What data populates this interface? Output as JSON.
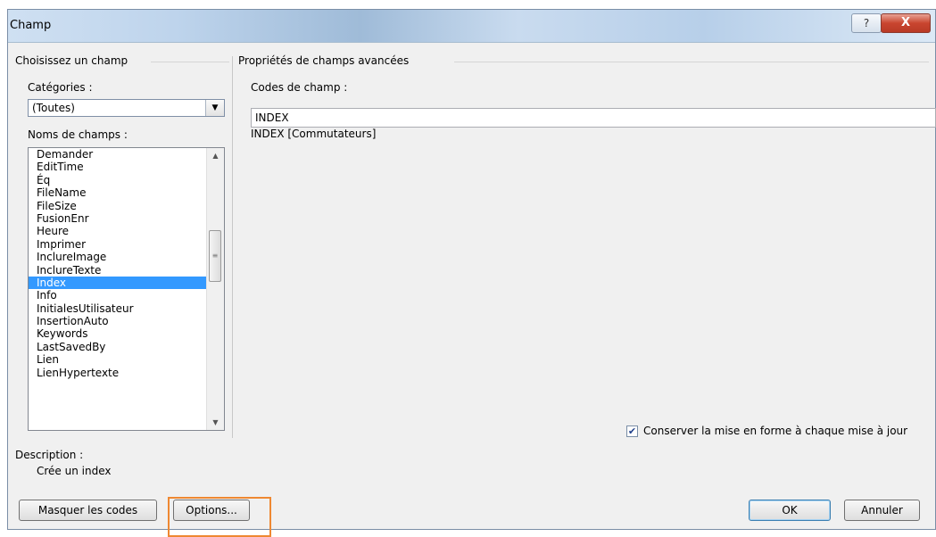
{
  "window": {
    "title": "Champ",
    "help_label": "?",
    "close_label": "X"
  },
  "left": {
    "group_title": "Choisissez un champ",
    "categories_label": "Catégories :",
    "category_selected": "(Toutes)",
    "names_label": "Noms de champs :",
    "field_names": [
      "Demander",
      "EditTime",
      "Éq",
      "FileName",
      "FileSize",
      "FusionEnr",
      "Heure",
      "Imprimer",
      "InclureImage",
      "InclureTexte",
      "Index",
      "Info",
      "InitialesUtilisateur",
      "InsertionAuto",
      "Keywords",
      "LastSavedBy",
      "Lien",
      "LienHypertexte"
    ],
    "selected_field": "Index",
    "description_label": "Description :",
    "description_text": "Crée un index"
  },
  "right": {
    "group_title": "Propriétés de champs avancées",
    "field_codes_label": "Codes de champ :",
    "field_codes_value": "INDEX",
    "syntax_hint": "INDEX [Commutateurs]",
    "preserve_format_label": "Conserver la mise en forme à chaque mise à jour",
    "preserve_format_checked": true
  },
  "buttons": {
    "hide_codes": "Masquer les codes",
    "options": "Options...",
    "ok": "OK",
    "cancel": "Annuler"
  },
  "colors": {
    "selection": "#3399ff",
    "highlight_frame": "#ee8832",
    "close_button": "#c9452f"
  },
  "icons": {
    "dropdown": "chevron-down-icon",
    "scroll_up": "scroll-up-icon",
    "scroll_down": "scroll-down-icon",
    "checkbox": "checkmark-icon"
  }
}
